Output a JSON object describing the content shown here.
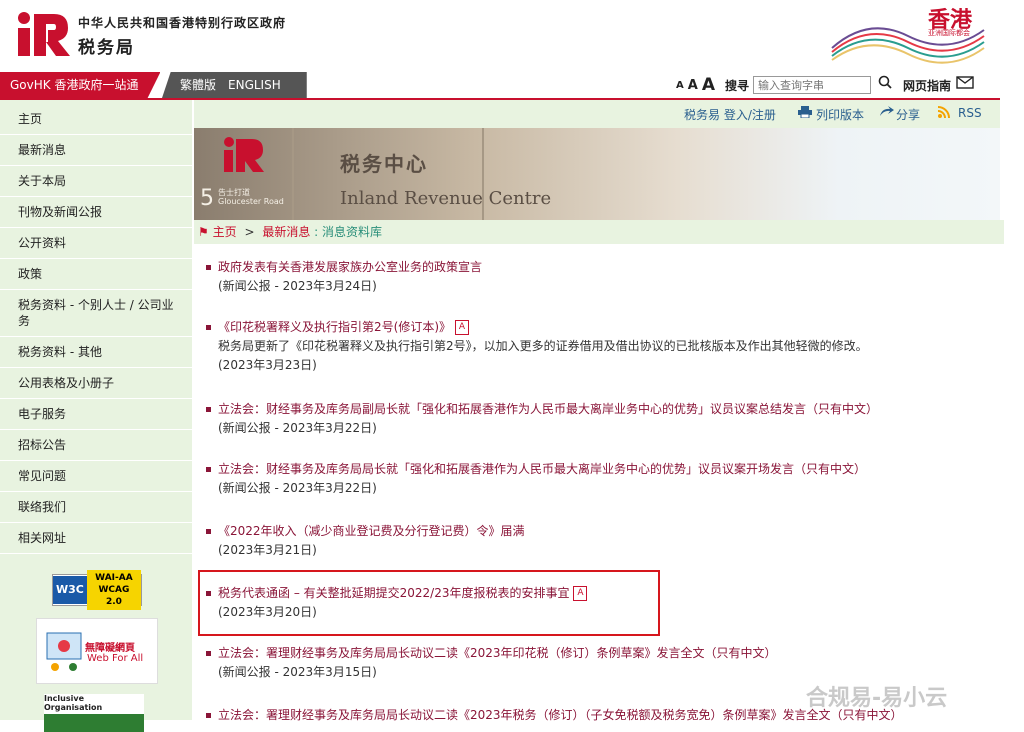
{
  "header": {
    "gov_name": "中华人民共和国香港特别行政区政府",
    "dept_name": "税务局",
    "brand_text": "香港",
    "brand_sub": "亚洲国际都会"
  },
  "topbar": {
    "govhk": "GovHK 香港政府一站通",
    "lang_trad": "繁體版",
    "lang_en": "ENGLISH",
    "font_small": "A",
    "font_mid": "A",
    "font_large": "A",
    "search_label": "搜寻",
    "search_placeholder": "输入查询字串",
    "guide": "网页指南"
  },
  "sidebar": {
    "items": [
      {
        "label": "主页"
      },
      {
        "label": "最新消息"
      },
      {
        "label": "关于本局"
      },
      {
        "label": "刊物及新闻公报"
      },
      {
        "label": "公开资料"
      },
      {
        "label": "政策"
      },
      {
        "label": "税务资料 - 个别人士 / 公司业务"
      },
      {
        "label": "税务资料 - 其他"
      },
      {
        "label": "公用表格及小册子"
      },
      {
        "label": "电子服务"
      },
      {
        "label": "招标公告"
      },
      {
        "label": "常见问题"
      },
      {
        "label": "联络我们"
      },
      {
        "label": "相关网址"
      }
    ],
    "badges": {
      "w3c": "W3C",
      "wai": "WAI-AA",
      "wcag": "WCAG 2.0",
      "wfa_title": "無障礙網頁",
      "wfa_sub": "Web For All",
      "incl": "Inclusive Organisation"
    }
  },
  "subtools": {
    "etax": "税务易 登入/注册",
    "print": "列印版本",
    "share": "分享",
    "rss": "RSS"
  },
  "banner": {
    "cn": "税务中心",
    "en": "Inland Revenue Centre",
    "num": "5",
    "road_cn": "告士打道",
    "road_en": "Gloucester Road"
  },
  "breadcrumb": {
    "home": "主页",
    "sep": ">",
    "news": "最新消息",
    "sep2": ":",
    "db": "消息资料库"
  },
  "news": [
    {
      "title": "政府发表有关香港发展家族办公室业务的政策宣言",
      "date": "(新闻公报 - 2023年3月24日)"
    },
    {
      "title": "《印花税署释义及执行指引第2号(修订本)》",
      "desc": "税务局更新了《印花税署释义及执行指引第2号》，以加入更多的证券借用及借出协议的已批核版本及作出其他轻微的修改。",
      "date": "(2023年3月23日)"
    },
    {
      "title": "立法会：财经事务及库务局副局长就「强化和拓展香港作为人民币最大离岸业务中心的优势」议员议案总结发言（只有中文）",
      "date": "(新闻公报 - 2023年3月22日)"
    },
    {
      "title": "立法会：财经事务及库务局局长就「强化和拓展香港作为人民币最大离岸业务中心的优势」议员议案开场发言（只有中文）",
      "date": "(新闻公报 - 2023年3月22日)"
    },
    {
      "title": "《2022年收入（减少商业登记费及分行登记费）令》届满",
      "date": "(2023年3月21日)"
    },
    {
      "title": "税务代表通函 – 有关整批延期提交2022/23年度报税表的安排事宜",
      "date": "(2023年3月20日)"
    },
    {
      "title": "立法会：署理财经事务及库务局局长动议二读《2023年印花税（修订）条例草案》发言全文（只有中文）",
      "date": "(新闻公报 - 2023年3月15日)"
    },
    {
      "title": "立法会：署理财经事务及库务局局长动议二读《2023年税务（修订）（子女免税额及税务宽免）条例草案》发言全文（只有中文）"
    }
  ],
  "watermark": "合规易-易小云",
  "colors": {
    "accent": "#c8102e",
    "sidebar_bg": "#e8f3e0",
    "link": "#8a1538"
  }
}
